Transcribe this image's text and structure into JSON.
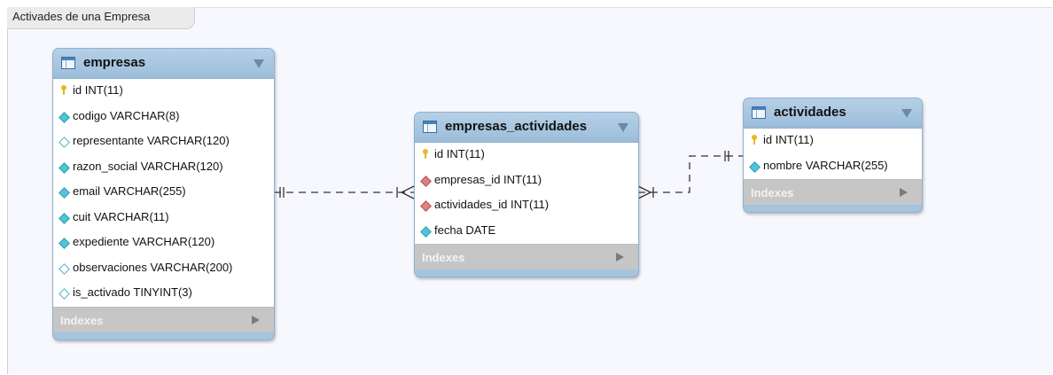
{
  "diagram": {
    "title": "Activades de una Empresa"
  },
  "tables": {
    "empresas": {
      "name": "empresas",
      "indexes_label": "Indexes",
      "columns": [
        {
          "label": "id INT(11)",
          "icon": "primary-key-icon"
        },
        {
          "label": "codigo VARCHAR(8)",
          "icon": "not-null-column-icon"
        },
        {
          "label": "representante VARCHAR(120)",
          "icon": "nullable-column-icon"
        },
        {
          "label": "razon_social VARCHAR(120)",
          "icon": "not-null-column-icon"
        },
        {
          "label": "email VARCHAR(255)",
          "icon": "not-null-column-icon"
        },
        {
          "label": "cuit VARCHAR(11)",
          "icon": "not-null-column-icon"
        },
        {
          "label": "expediente VARCHAR(120)",
          "icon": "not-null-column-icon"
        },
        {
          "label": "observaciones VARCHAR(200)",
          "icon": "nullable-column-icon"
        },
        {
          "label": "is_activado TINYINT(3)",
          "icon": "nullable-column-icon"
        }
      ]
    },
    "empresas_actividades": {
      "name": "empresas_actividades",
      "indexes_label": "Indexes",
      "columns": [
        {
          "label": "id INT(11)",
          "icon": "primary-key-icon"
        },
        {
          "label": "empresas_id INT(11)",
          "icon": "foreign-key-icon"
        },
        {
          "label": "actividades_id INT(11)",
          "icon": "foreign-key-icon"
        },
        {
          "label": "fecha DATE",
          "icon": "not-null-column-icon"
        }
      ]
    },
    "actividades": {
      "name": "actividades",
      "indexes_label": "Indexes",
      "columns": [
        {
          "label": "id INT(11)",
          "icon": "primary-key-icon"
        },
        {
          "label": "nombre VARCHAR(255)",
          "icon": "not-null-column-icon"
        }
      ]
    }
  },
  "colors": {
    "header": "#a5c4de",
    "indexes_bar": "#c6c6c6",
    "canvas": "#f7f7fe",
    "relationship_line": "#333333"
  }
}
